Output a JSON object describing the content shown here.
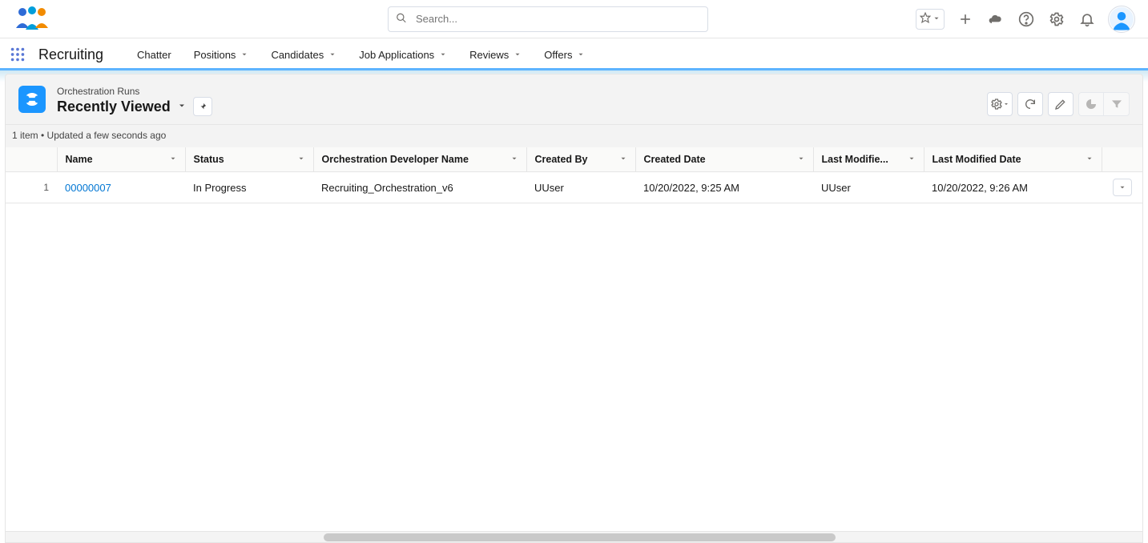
{
  "header": {
    "search_placeholder": "Search...",
    "icons": {
      "star": "star-icon",
      "caret": "caret-down-icon",
      "plus": "plus-icon",
      "cloud": "cloud-icon",
      "question": "question-icon",
      "gear": "gear-icon",
      "bell": "bell-icon",
      "avatar": "avatar"
    }
  },
  "nav": {
    "app_name": "Recruiting",
    "items": [
      {
        "label": "Chatter",
        "has_menu": false
      },
      {
        "label": "Positions",
        "has_menu": true
      },
      {
        "label": "Candidates",
        "has_menu": true
      },
      {
        "label": "Job Applications",
        "has_menu": true
      },
      {
        "label": "Reviews",
        "has_menu": true
      },
      {
        "label": "Offers",
        "has_menu": true
      }
    ]
  },
  "page": {
    "object_label": "Orchestration Runs",
    "list_view": "Recently Viewed",
    "meta": "1 item • Updated a few seconds ago"
  },
  "table": {
    "columns": [
      {
        "label": "Name"
      },
      {
        "label": "Status"
      },
      {
        "label": "Orchestration Developer Name"
      },
      {
        "label": "Created By"
      },
      {
        "label": "Created Date"
      },
      {
        "label": "Last Modifie..."
      },
      {
        "label": "Last Modified Date"
      }
    ],
    "rows": [
      {
        "num": "1",
        "name": "00000007",
        "status": "In Progress",
        "dev_name": "Recruiting_Orchestration_v6",
        "created_by": "UUser",
        "created_date": "10/20/2022, 9:25 AM",
        "last_modified_by": "UUser",
        "last_modified_date": "10/20/2022, 9:26 AM"
      }
    ]
  },
  "colors": {
    "link": "#0176d3",
    "accent": "#5eb4ff",
    "icon_bg": "#1b96ff"
  }
}
